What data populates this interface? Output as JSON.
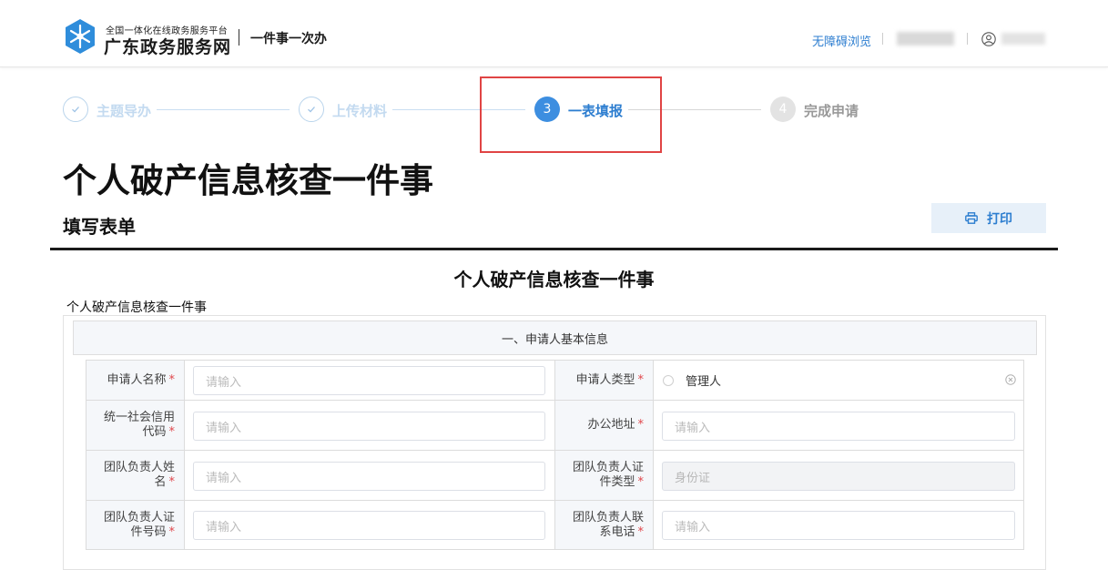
{
  "header": {
    "logo_small": "全国一体化在线政务服务平台",
    "logo_big": "广东政务服务网",
    "subtitle": "一件事一次办",
    "accessibility": "无障碍浏览",
    "user_icon": "user-circle-icon",
    "accent": "#2d7ed0"
  },
  "steps": [
    {
      "num": "1",
      "label": "主题导办",
      "state": "done"
    },
    {
      "num": "2",
      "label": "上传材料",
      "state": "done"
    },
    {
      "num": "3",
      "label": "一表填报",
      "state": "active"
    },
    {
      "num": "4",
      "label": "完成申请",
      "state": "todo"
    }
  ],
  "page": {
    "title": "个人破产信息核查一件事",
    "section": "填写表单",
    "print_label": "打印"
  },
  "form": {
    "heading": "个人破产信息核查一件事",
    "subheading": "个人破产信息核查一件事",
    "group_title": "一、申请人基本信息",
    "rows": [
      {
        "left_label": "申请人名称",
        "left_placeholder": "请输入",
        "right_label": "申请人类型",
        "right_option": "管理人"
      },
      {
        "left_label": "统一社会信用代码",
        "left_placeholder": "请输入",
        "right_label": "办公地址",
        "right_placeholder": "请输入"
      },
      {
        "left_label": "团队负责人姓名",
        "left_placeholder": "请输入",
        "right_label": "团队负责人证件类型",
        "right_value": "身份证"
      },
      {
        "left_label": "团队负责人证件号码",
        "left_placeholder": "请输入",
        "right_label": "团队负责人联系电话",
        "right_placeholder": "请输入"
      }
    ],
    "required_mark": "*"
  }
}
